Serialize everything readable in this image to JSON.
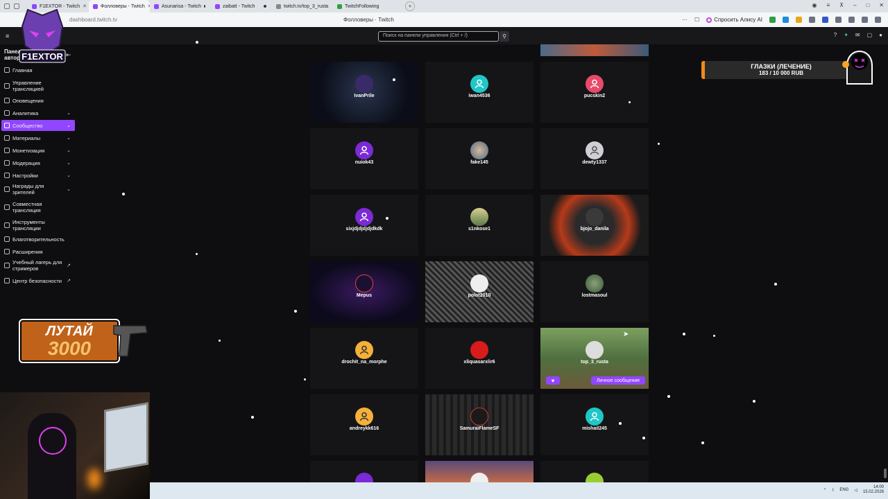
{
  "browser": {
    "tabs": [
      {
        "label": "F1EXTOR - Twitch",
        "state": "close"
      },
      {
        "label": "Фолловеры - Twitch",
        "state": "active"
      },
      {
        "label": "Asunarisa - Twitch",
        "state": "dot"
      },
      {
        "label": "zaibatt - Twitch",
        "state": "dot"
      },
      {
        "label": "twitch.tv/top_3_rusta",
        "state": "dot"
      },
      {
        "label": "TwitchFollowing",
        "state": "none"
      }
    ],
    "address_url": "dashboard.twitch.tv",
    "page_title": "Фолловеры · Twitch",
    "alisa_label": "Спросить Алису AI"
  },
  "header": {
    "search_placeholder": "Поиск на панели управления (Ctrl + /)"
  },
  "sidebar": {
    "title": "Панель управления автора",
    "items": [
      {
        "label": "Главная",
        "chevron": false,
        "active": false
      },
      {
        "label": "Управление трансляцией",
        "chevron": false,
        "active": false
      },
      {
        "label": "Оповещения",
        "chevron": false,
        "active": false
      },
      {
        "label": "Аналитика",
        "chevron": true,
        "active": false
      },
      {
        "label": "Сообщество",
        "chevron": true,
        "active": true
      },
      {
        "label": "Материалы",
        "chevron": true,
        "active": false
      },
      {
        "label": "Монетизация",
        "chevron": true,
        "active": false
      },
      {
        "label": "Модерация",
        "chevron": true,
        "active": false
      },
      {
        "label": "Настройки",
        "chevron": true,
        "active": false
      },
      {
        "label": "Награды для зрителей",
        "chevron": true,
        "active": false
      },
      {
        "label": "Совместная трансляция",
        "chevron": false,
        "active": false
      },
      {
        "label": "Инструменты трансляции",
        "chevron": false,
        "active": false
      },
      {
        "label": "Благотворительность",
        "chevron": false,
        "active": false
      },
      {
        "label": "Расширения",
        "chevron": false,
        "active": false
      },
      {
        "label": "Учебный лагерь для стримеров",
        "chevron": false,
        "active": false,
        "external": true
      },
      {
        "label": "Центр безопасности",
        "chevron": false,
        "active": false,
        "external": true
      }
    ]
  },
  "overlay": {
    "logo_text": "F1EXTOR",
    "promo_line1": "ЛУТАЙ",
    "promo_line2": "3000",
    "goal_title": "ГЛАЗКИ (ЛЕЧЕНИЕ)",
    "goal_progress": "183 / 10 000 RUB",
    "goal_fraction": 0.0183
  },
  "followers": [
    {
      "name": "IvanPrile",
      "avatar": "photo-dark"
    },
    {
      "name": "iwan4536",
      "avatar": "#1fc7c7"
    },
    {
      "name": "pucskin2",
      "avatar": "#e84a6a"
    },
    {
      "name": "nuiok43",
      "avatar": "#7b2ad6"
    },
    {
      "name": "fake145",
      "avatar": "photo"
    },
    {
      "name": "dewty1337",
      "avatar": "#cfcfd6"
    },
    {
      "name": "sixjdjdjdjdjdkdk",
      "avatar": "#7b2ad6"
    },
    {
      "name": "s1nkose1",
      "avatar": "photo"
    },
    {
      "name": "bjojo_danila",
      "avatar": "photo-bjojo"
    },
    {
      "name": "Mepus",
      "avatar": "photo-mepus"
    },
    {
      "name": "polot2010",
      "avatar": "photo-comic"
    },
    {
      "name": "lostmasoul",
      "avatar": "photo"
    },
    {
      "name": "drochit_na_morphe",
      "avatar": "#f5b03a"
    },
    {
      "name": "xliquasarxlir6",
      "avatar": "#d81b1b"
    },
    {
      "name": "top_3_rusta",
      "avatar": "photo-game"
    },
    {
      "name": "andreykk616",
      "avatar": "#f5b03a"
    },
    {
      "name": "SamuraiFlameSF",
      "avatar": "photo-city"
    },
    {
      "name": "mishail245",
      "avatar": "#1fc7c7"
    }
  ],
  "hover_card": {
    "dm_label": "Личное сообщение",
    "heart_icon": "heart-icon"
  },
  "taskbar": {
    "lang": "ENG",
    "time": "14:00",
    "date": "15.02.2026"
  }
}
